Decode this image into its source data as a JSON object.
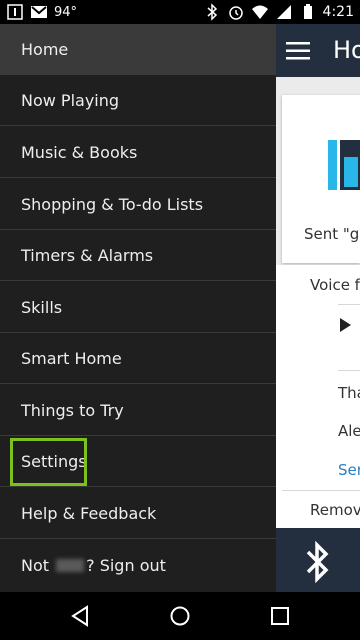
{
  "status_bar": {
    "temperature": "94°",
    "time": "4:21",
    "icons": [
      "notification-icon",
      "gmail-icon",
      "bluetooth-icon",
      "alarm-icon",
      "wifi-icon",
      "signal-icon",
      "battery-icon"
    ]
  },
  "drawer": {
    "items": [
      {
        "label": "Home",
        "active": true
      },
      {
        "label": "Now Playing"
      },
      {
        "label": "Music & Books"
      },
      {
        "label": "Shopping & To-do Lists"
      },
      {
        "label": "Timers & Alarms"
      },
      {
        "label": "Skills"
      },
      {
        "label": "Smart Home"
      },
      {
        "label": "Things to Try"
      },
      {
        "label": "Settings",
        "highlighted": true
      },
      {
        "label": "Help & Feedback"
      }
    ],
    "sign_out": {
      "prefix": "Not ",
      "suffix": "? Sign out"
    }
  },
  "app": {
    "title": "Ho",
    "card_text": "Sent \"ga",
    "voice_label": "Voice fe",
    "row1": "Tha",
    "row2": "Ale",
    "link": "Ser",
    "remove": "Remove"
  },
  "colors": {
    "highlight": "#7cc11f",
    "app_header": "#232f3e",
    "accent_blue": "#29b6e8"
  }
}
